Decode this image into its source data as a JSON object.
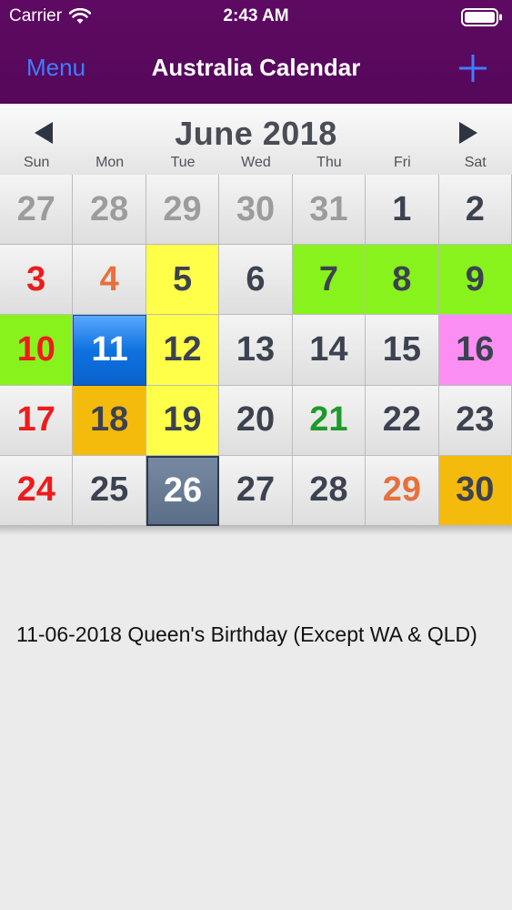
{
  "status_bar": {
    "carrier": "Carrier",
    "time": "2:43 AM"
  },
  "nav": {
    "menu_label": "Menu",
    "title": "Australia Calendar",
    "add_icon": "plus-icon"
  },
  "calendar": {
    "month_title": "June 2018",
    "prev_icon": "left-triangle-icon",
    "next_icon": "right-triangle-icon",
    "weekdays": [
      "Sun",
      "Mon",
      "Tue",
      "Wed",
      "Thu",
      "Fri",
      "Sat"
    ],
    "selected_day": "11",
    "today_day": "26",
    "colors": {
      "header_purple": "#5e0a63",
      "yellow": "#ffff4a",
      "green": "#88f21c",
      "pink": "#fb8ef3",
      "gold": "#f5bb0c",
      "selected_blue": "#0e72e0",
      "today_slate": "#5b6e88"
    },
    "weeks": [
      [
        {
          "day": "27",
          "style": "outside"
        },
        {
          "day": "28",
          "style": "outside"
        },
        {
          "day": "29",
          "style": "outside"
        },
        {
          "day": "30",
          "style": "outside"
        },
        {
          "day": "31",
          "style": "outside"
        },
        {
          "day": "1",
          "style": ""
        },
        {
          "day": "2",
          "style": ""
        }
      ],
      [
        {
          "day": "3",
          "style": "red"
        },
        {
          "day": "4",
          "style": "orange"
        },
        {
          "day": "5",
          "style": "bg-yellow"
        },
        {
          "day": "6",
          "style": ""
        },
        {
          "day": "7",
          "style": "bg-green"
        },
        {
          "day": "8",
          "style": "bg-green"
        },
        {
          "day": "9",
          "style": "bg-green"
        }
      ],
      [
        {
          "day": "10",
          "style": "red bg-green"
        },
        {
          "day": "11",
          "style": "selected"
        },
        {
          "day": "12",
          "style": "bg-yellow"
        },
        {
          "day": "13",
          "style": ""
        },
        {
          "day": "14",
          "style": ""
        },
        {
          "day": "15",
          "style": ""
        },
        {
          "day": "16",
          "style": "bg-pink"
        }
      ],
      [
        {
          "day": "17",
          "style": "red"
        },
        {
          "day": "18",
          "style": "bg-gold"
        },
        {
          "day": "19",
          "style": "bg-yellow"
        },
        {
          "day": "20",
          "style": ""
        },
        {
          "day": "21",
          "style": "green-text"
        },
        {
          "day": "22",
          "style": ""
        },
        {
          "day": "23",
          "style": ""
        }
      ],
      [
        {
          "day": "24",
          "style": "red"
        },
        {
          "day": "25",
          "style": ""
        },
        {
          "day": "26",
          "style": "today"
        },
        {
          "day": "27",
          "style": ""
        },
        {
          "day": "28",
          "style": ""
        },
        {
          "day": "29",
          "style": "orange"
        },
        {
          "day": "30",
          "style": "bg-gold"
        }
      ]
    ]
  },
  "event": {
    "text": "11-06-2018 Queen's Birthday (Except WA & QLD)"
  }
}
